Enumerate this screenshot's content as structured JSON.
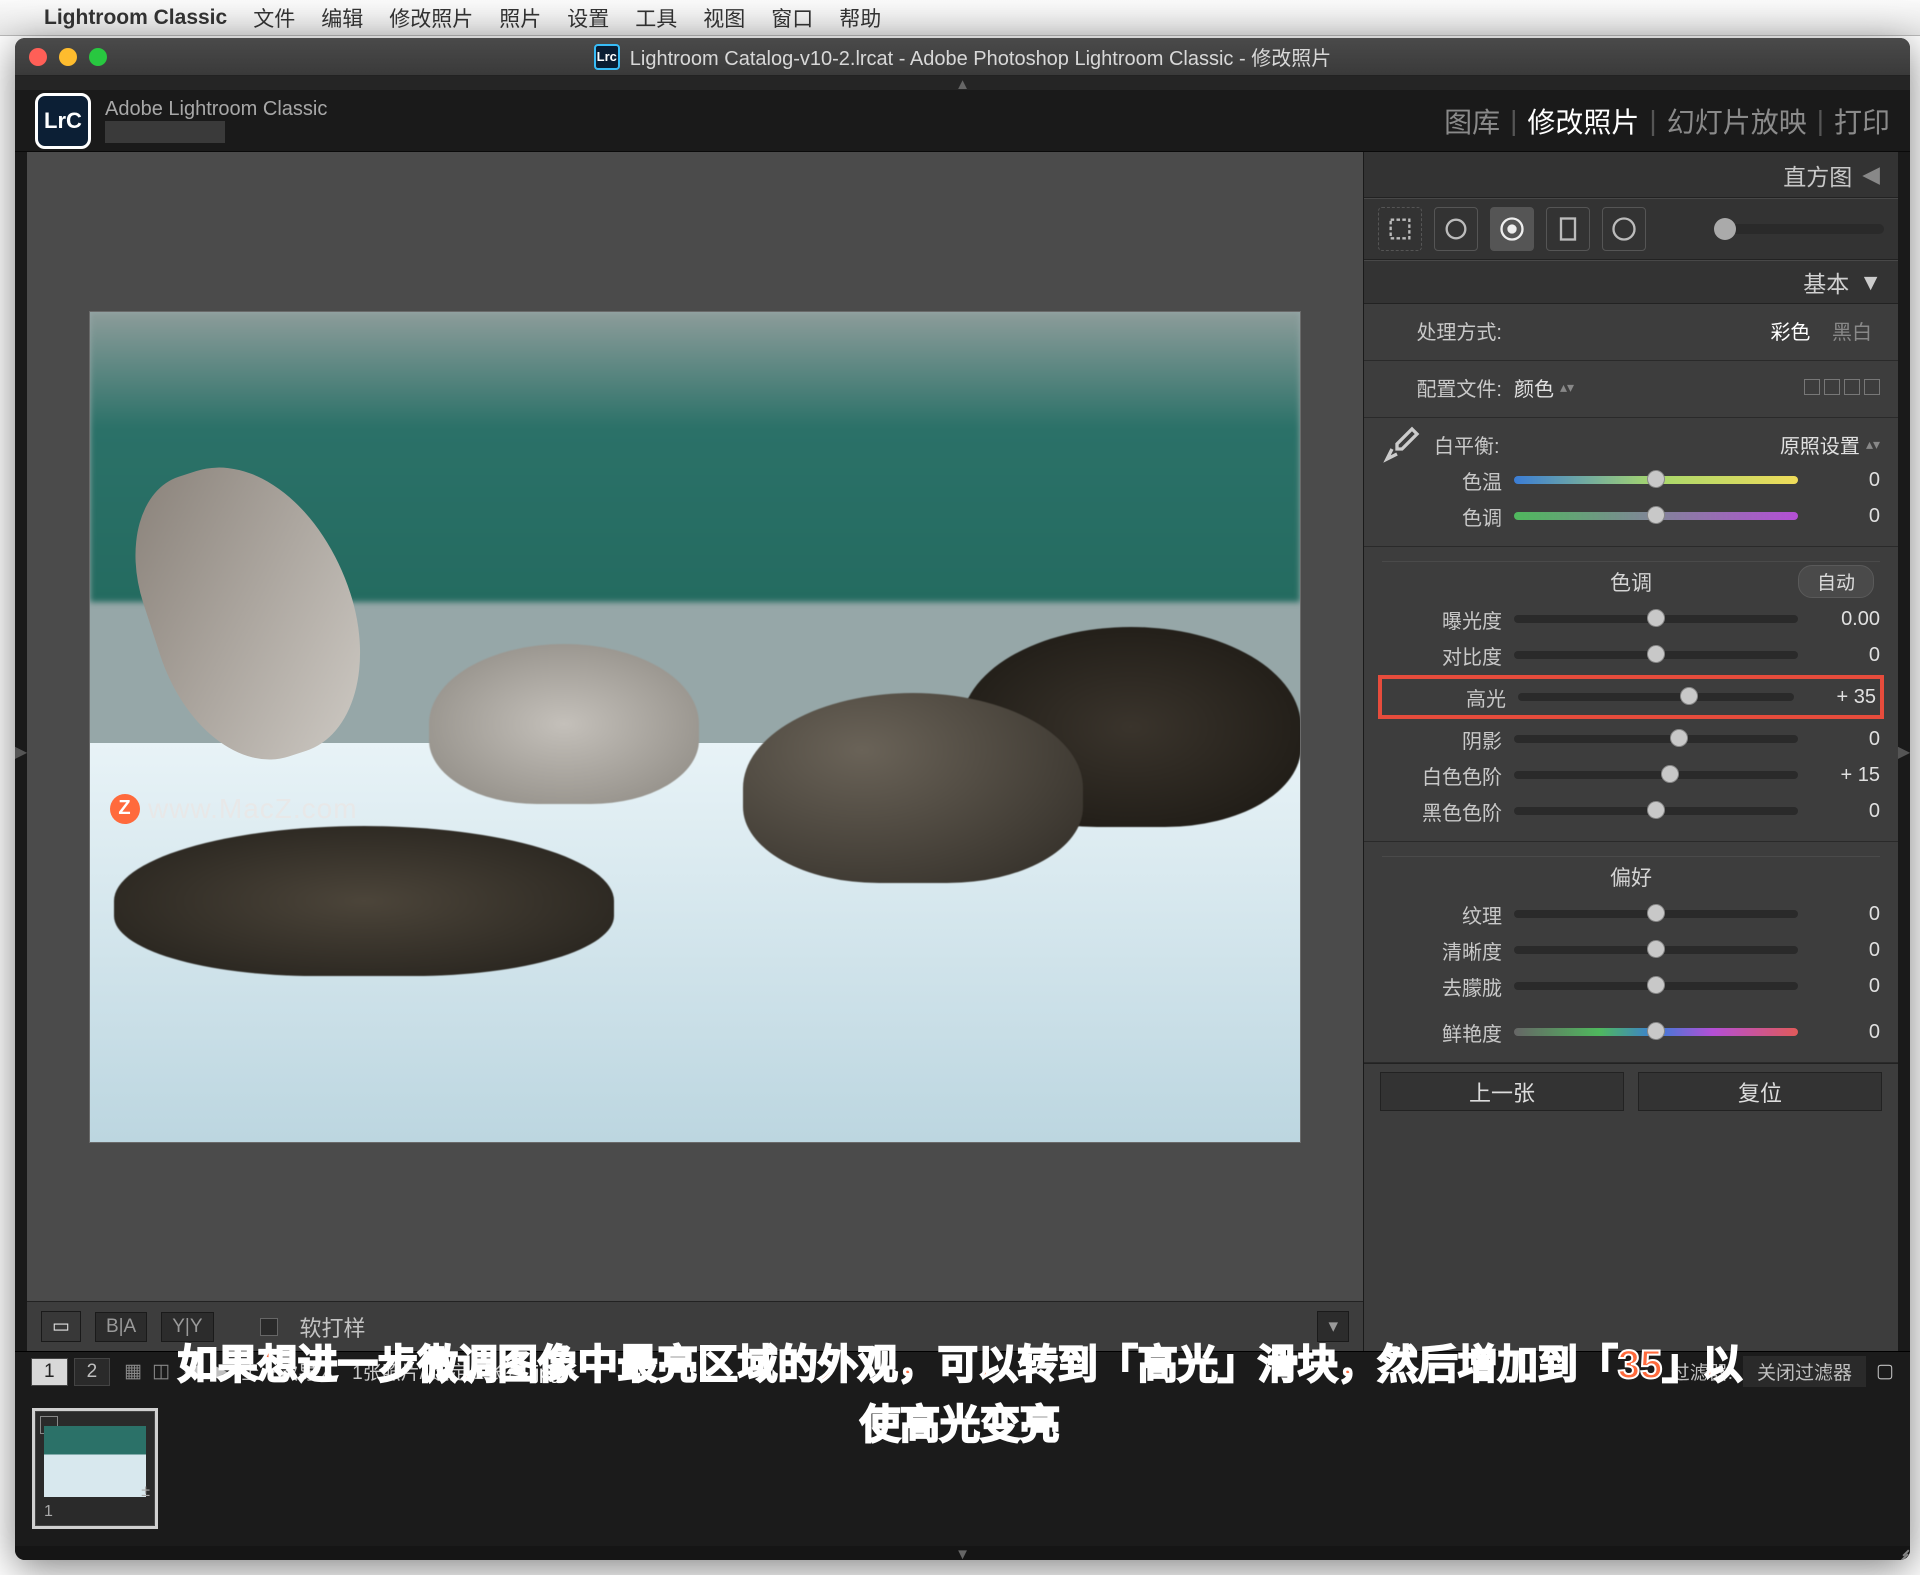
{
  "menubar": {
    "apple": "",
    "appname": "Lightroom Classic",
    "items": [
      "文件",
      "编辑",
      "修改照片",
      "照片",
      "设置",
      "工具",
      "视图",
      "窗口",
      "帮助"
    ]
  },
  "window": {
    "title": "Lightroom Catalog-v10-2.lrcat - Adobe Photoshop Lightroom Classic - 修改照片",
    "lrc_badge": "Lrc"
  },
  "identity": {
    "lrc": "LrC",
    "label": "Adobe Lightroom Classic",
    "modules": [
      "图库",
      "修改照片",
      "幻灯片放映",
      "打印"
    ],
    "active_module": "修改照片"
  },
  "histogram_panel": {
    "title": "直方图"
  },
  "basic_panel": {
    "title": "基本",
    "treatment_label": "处理方式:",
    "treatment_color": "彩色",
    "treatment_bw": "黑白",
    "profile_label": "配置文件:",
    "profile_value": "颜色",
    "wb_label": "白平衡:",
    "wb_value": "原照设置",
    "temp_label": "色温",
    "temp_value": "0",
    "tint_label": "色调",
    "tint_value": "0",
    "tone_header": "色调",
    "tone_auto": "自动",
    "exposure_label": "曝光度",
    "exposure_value": "0.00",
    "contrast_label": "对比度",
    "contrast_value": "0",
    "highlights_label": "高光",
    "highlights_value": "+ 35",
    "shadows_label": "阴影",
    "shadows_value": "0",
    "whites_label": "白色色阶",
    "whites_value": "+ 15",
    "blacks_label": "黑色色阶",
    "blacks_value": "0",
    "presence_header": "偏好",
    "texture_label": "纹理",
    "texture_value": "0",
    "clarity_label": "清晰度",
    "clarity_value": "0",
    "dehaze_label": "去朦胧",
    "dehaze_value": "0",
    "vibrance_label": "鲜艳度",
    "vibrance_value": "0"
  },
  "canvas_toolbar": {
    "loupe": "▭",
    "ba": "B|A",
    "yy": "Y|Y",
    "softproof": "软打样"
  },
  "nav": {
    "prev": "上一张",
    "reset": "复位"
  },
  "filterbar": {
    "tab1": "1",
    "tab2": "2",
    "path_prefix": "上一次导入",
    "path_mid": "1张照片/ 选定 1张 /",
    "path_file": "1.jpg",
    "filter_label": "过滤器:",
    "filter_value": "关闭过滤器"
  },
  "filmstrip": {
    "thumb_index": "1"
  },
  "watermark": "www.MacZ.com",
  "caption_line1": "如果想进一步微调图像中最亮区域的外观，可以转到「高光」滑块，然后增加到「35」以",
  "caption_line2": "使高光变亮",
  "slider_positions": {
    "temp": 50,
    "tint": 50,
    "exposure": 50,
    "contrast": 50,
    "highlights": 62,
    "shadows": 58,
    "whites": 55,
    "blacks": 50,
    "texture": 50,
    "clarity": 50,
    "dehaze": 50,
    "vibrance": 50
  }
}
